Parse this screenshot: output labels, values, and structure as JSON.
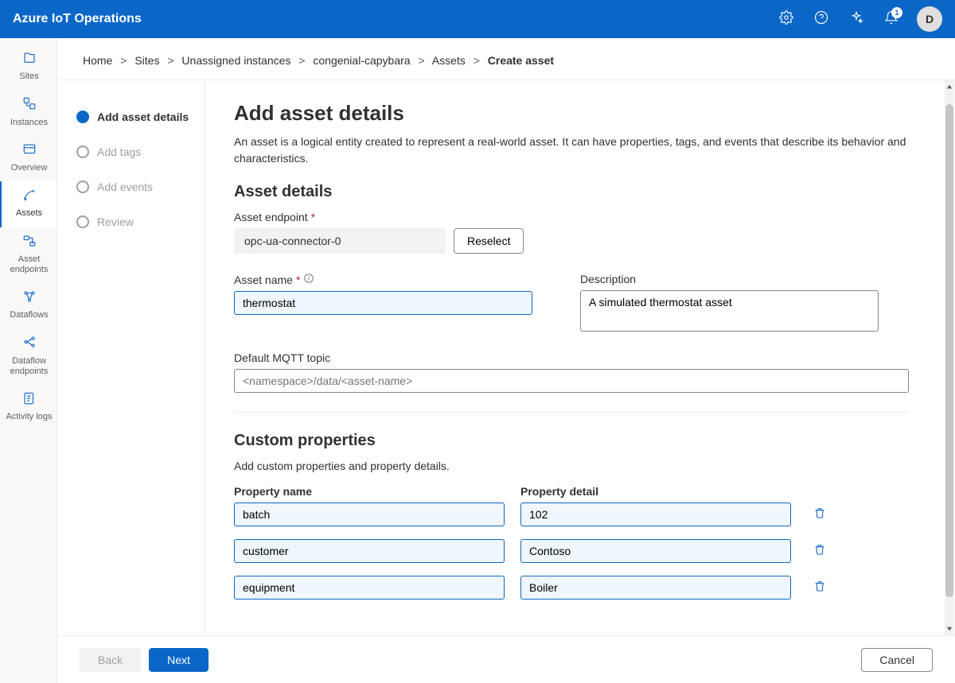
{
  "header": {
    "app_title": "Azure IoT Operations",
    "notification_count": "1",
    "avatar_initial": "D"
  },
  "rail": {
    "items": [
      {
        "label": "Sites"
      },
      {
        "label": "Instances"
      },
      {
        "label": "Overview"
      },
      {
        "label": "Assets"
      },
      {
        "label": "Asset endpoints"
      },
      {
        "label": "Dataflows"
      },
      {
        "label": "Dataflow endpoints"
      },
      {
        "label": "Activity logs"
      }
    ],
    "active_index": 3
  },
  "breadcrumbs": {
    "items": [
      "Home",
      "Sites",
      "Unassigned instances",
      "congenial-capybara",
      "Assets"
    ],
    "current": "Create asset",
    "separator": ">"
  },
  "wizard": {
    "steps": [
      {
        "label": "Add asset details"
      },
      {
        "label": "Add tags"
      },
      {
        "label": "Add events"
      },
      {
        "label": "Review"
      }
    ],
    "active_index": 0
  },
  "page": {
    "title": "Add asset details",
    "intro": "An asset is a logical entity created to represent a real-world asset. It can have properties, tags, and events that describe its behavior and characteristics.",
    "section_details": "Asset details",
    "endpoint_label": "Asset endpoint",
    "endpoint_value": "opc-ua-connector-0",
    "reselect_label": "Reselect",
    "name_label": "Asset name",
    "name_value": "thermostat",
    "desc_label": "Description",
    "desc_value": "A simulated thermostat asset",
    "mqtt_label": "Default MQTT topic",
    "mqtt_placeholder": "<namespace>/data/<asset-name>",
    "section_props": "Custom properties",
    "props_sub": "Add custom properties and property details.",
    "col_name": "Property name",
    "col_detail": "Property detail",
    "props": [
      {
        "name": "batch",
        "detail": "102"
      },
      {
        "name": "customer",
        "detail": "Contoso"
      },
      {
        "name": "equipment",
        "detail": "Boiler"
      }
    ]
  },
  "footer": {
    "back": "Back",
    "next": "Next",
    "cancel": "Cancel"
  }
}
